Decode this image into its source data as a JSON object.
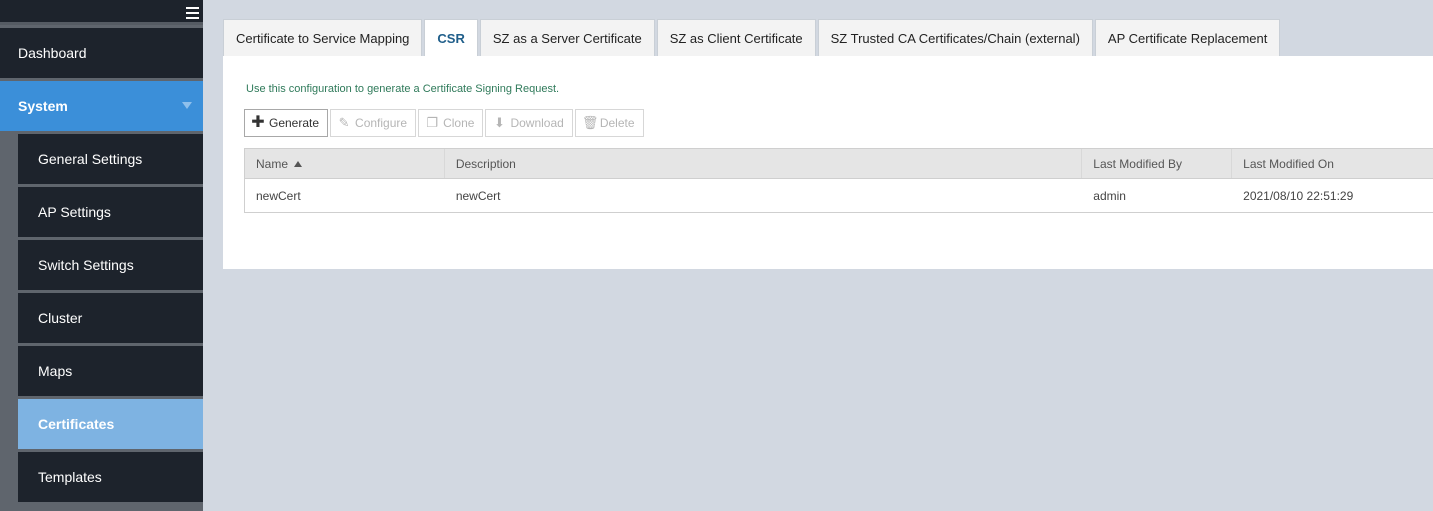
{
  "sidebar": {
    "items": [
      {
        "label": "Dashboard"
      },
      {
        "label": "System"
      },
      {
        "label": "General Settings"
      },
      {
        "label": "AP Settings"
      },
      {
        "label": "Switch Settings"
      },
      {
        "label": "Cluster"
      },
      {
        "label": "Maps"
      },
      {
        "label": "Certificates"
      },
      {
        "label": "Templates"
      }
    ]
  },
  "tabs": [
    {
      "label": "Certificate to Service Mapping"
    },
    {
      "label": "CSR"
    },
    {
      "label": "SZ as a Server Certificate"
    },
    {
      "label": "SZ as Client Certificate"
    },
    {
      "label": "SZ Trusted CA Certificates/Chain (external)"
    },
    {
      "label": "AP Certificate Replacement"
    }
  ],
  "panel": {
    "hint": "Use this configuration to generate a Certificate Signing Request."
  },
  "toolbar": {
    "generate": "Generate",
    "configure": "Configure",
    "clone": "Clone",
    "download": "Download",
    "delete": "Delete"
  },
  "table": {
    "headers": [
      "Name",
      "Description",
      "Last Modified By",
      "Last Modified On"
    ],
    "rows": [
      [
        "newCert",
        "newCert",
        "admin",
        "2021/08/10 22:51:29"
      ]
    ]
  },
  "colors": {
    "sidebar_bg": "#1d232c",
    "system_active": "#3b8fd9",
    "certificates_active": "#7eb3e2",
    "page_bg": "#d2d8e1"
  }
}
